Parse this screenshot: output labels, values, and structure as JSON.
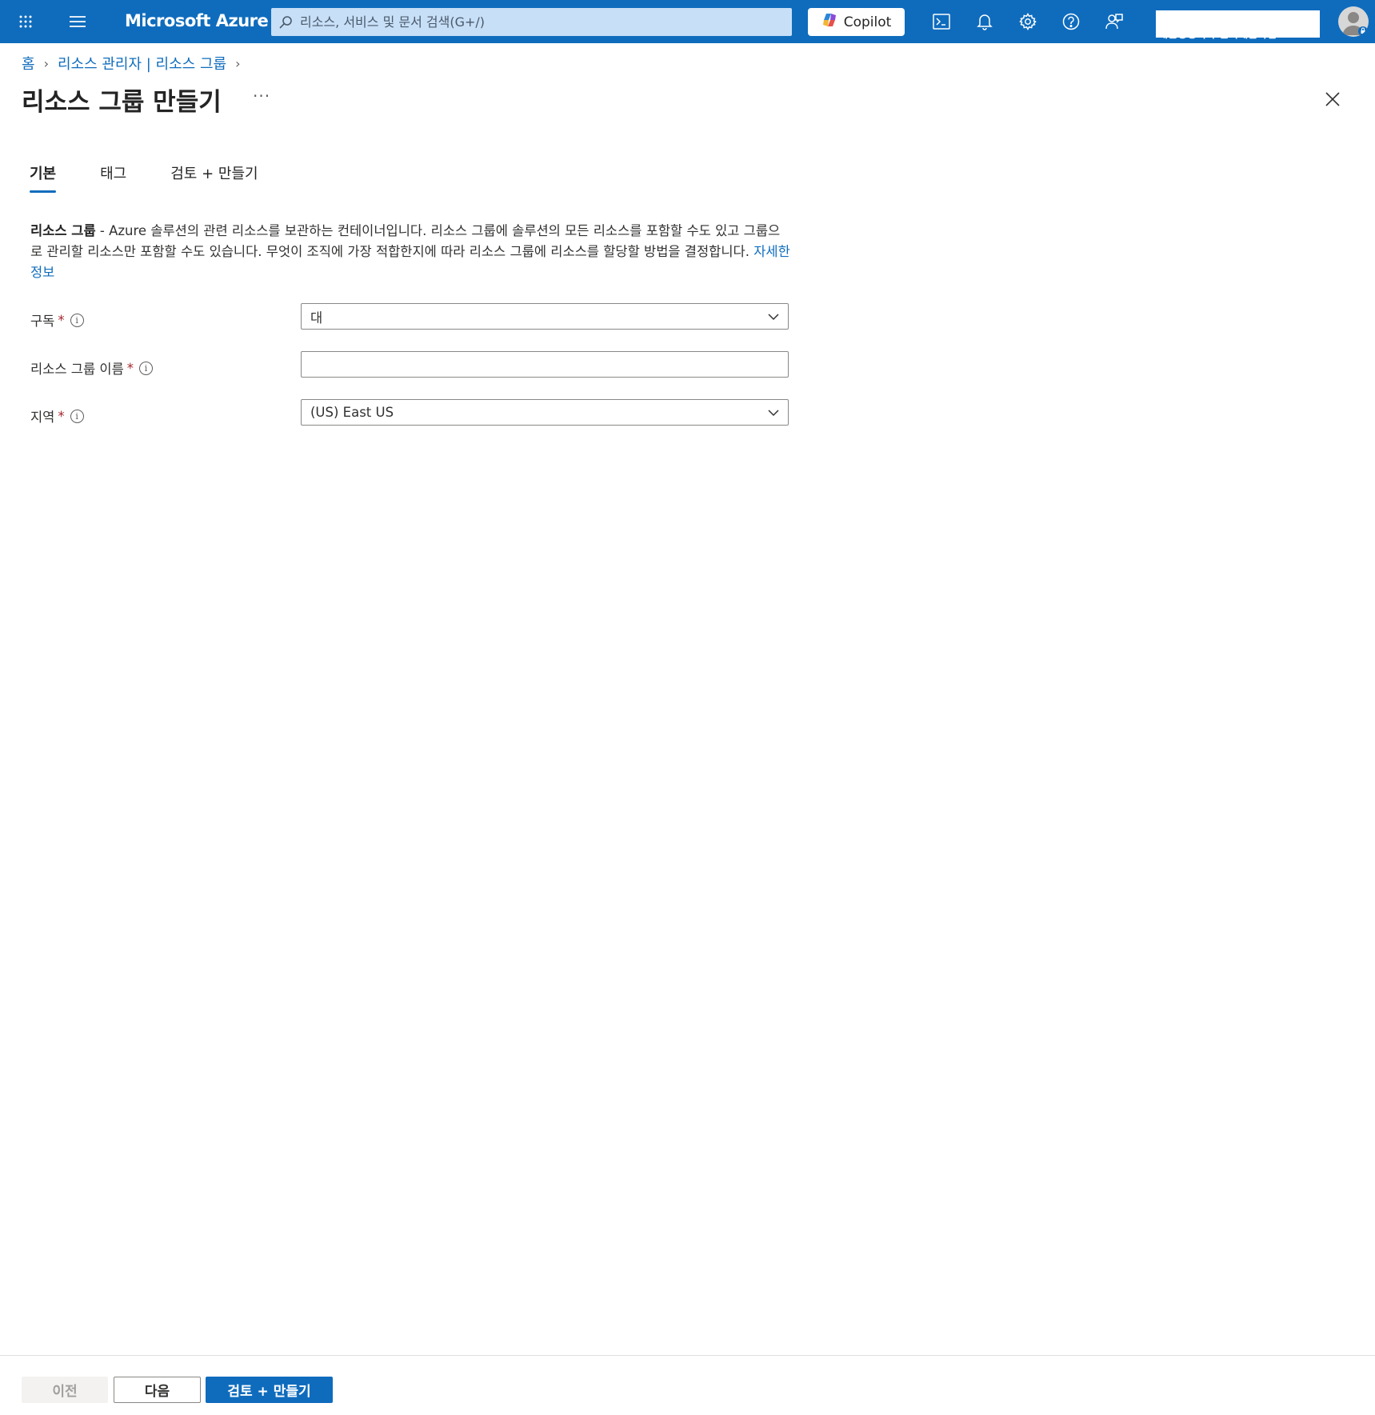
{
  "topbar": {
    "brand": "Microsoft Azure",
    "search_placeholder": "리소스, 서비스 및 문서 검색(G+/)",
    "copilot_label": "Copilot",
    "account_directory": "대한정형외과 한국개발사업...",
    "brand_color": "#0f6cbd"
  },
  "breadcrumb": {
    "home": "홈",
    "parent": "리소스 관리자 | 리소스 그룹"
  },
  "page": {
    "title": "리소스 그룹 만들기",
    "more": "···"
  },
  "tabs": [
    "기본",
    "태그",
    "검토 + 만들기"
  ],
  "description": {
    "bold": "리소스 그룹",
    "text": " - Azure 솔루션의 관련 리소스를 보관하는 컨테이너입니다. 리소스 그룹에 솔루션의 모든 리소스를 포함할 수도 있고 그룹으로 관리할 리소스만 포함할 수도 있습니다. 무엇이 조직에 가장 적합한지에 따라 리소스 그룹에 리소스를 할당할 방법을 결정합니다. ",
    "link": "자세한 정보"
  },
  "form": {
    "subscription": {
      "label": "구독",
      "required": "*",
      "value": "대"
    },
    "rg_name": {
      "label": "리소스 그룹 이름",
      "required": "*",
      "value": ""
    },
    "region": {
      "label": "지역",
      "required": "*",
      "value": "(US) East US"
    }
  },
  "footer": {
    "prev": "이전",
    "next": "다음",
    "review": "검토 + 만들기"
  }
}
